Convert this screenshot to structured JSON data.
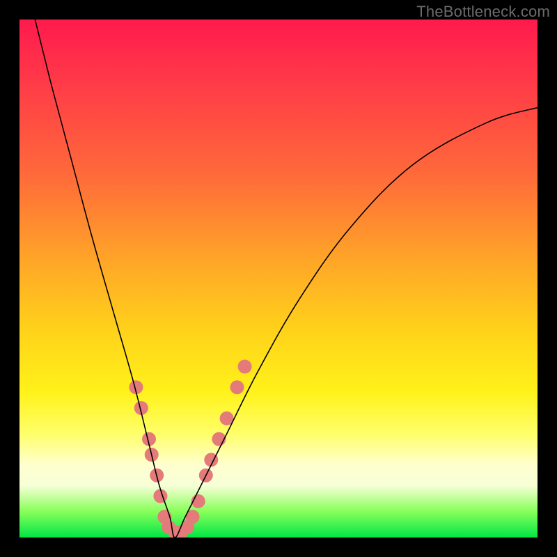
{
  "watermark": {
    "text": "TheBottleneck.com"
  },
  "chart_data": {
    "type": "line",
    "title": "",
    "xlabel": "",
    "ylabel": "",
    "xlim": [
      0,
      100
    ],
    "ylim": [
      0,
      100
    ],
    "grid": false,
    "legend": false,
    "series": [
      {
        "name": "bottleneck-curve",
        "x": [
          3,
          6,
          10,
          14,
          18,
          22,
          25,
          27,
          29,
          30,
          32,
          35,
          40,
          46,
          54,
          64,
          76,
          90,
          100
        ],
        "y": [
          100,
          88,
          73,
          58,
          44,
          30,
          18,
          10,
          4,
          0,
          4,
          10,
          20,
          32,
          46,
          60,
          72,
          80,
          83
        ],
        "stroke": "#000000",
        "width": 1.6
      }
    ],
    "markers": {
      "name": "highlight-dots",
      "color": "#e47a7a",
      "radius_px": 10,
      "points": [
        {
          "x": 22.5,
          "y": 29
        },
        {
          "x": 23.5,
          "y": 25
        },
        {
          "x": 25.0,
          "y": 19
        },
        {
          "x": 25.5,
          "y": 16
        },
        {
          "x": 26.5,
          "y": 12
        },
        {
          "x": 27.2,
          "y": 8
        },
        {
          "x": 28.0,
          "y": 4
        },
        {
          "x": 28.8,
          "y": 2
        },
        {
          "x": 30.0,
          "y": 1
        },
        {
          "x": 31.2,
          "y": 1
        },
        {
          "x": 32.4,
          "y": 2
        },
        {
          "x": 33.4,
          "y": 4
        },
        {
          "x": 34.5,
          "y": 7
        },
        {
          "x": 36.0,
          "y": 12
        },
        {
          "x": 37.0,
          "y": 15
        },
        {
          "x": 38.5,
          "y": 19
        },
        {
          "x": 40.0,
          "y": 23
        },
        {
          "x": 42.0,
          "y": 29
        },
        {
          "x": 43.5,
          "y": 33
        }
      ]
    },
    "gradient_stops": [
      {
        "pos": 0,
        "color": "#ff1a4d"
      },
      {
        "pos": 12,
        "color": "#ff3a48"
      },
      {
        "pos": 30,
        "color": "#ff6a3a"
      },
      {
        "pos": 45,
        "color": "#ffa029"
      },
      {
        "pos": 60,
        "color": "#ffd21a"
      },
      {
        "pos": 72,
        "color": "#fff21a"
      },
      {
        "pos": 80,
        "color": "#ffff6a"
      },
      {
        "pos": 86,
        "color": "#ffffd0"
      },
      {
        "pos": 90,
        "color": "#f6ffd6"
      },
      {
        "pos": 95,
        "color": "#87ff5a"
      },
      {
        "pos": 100,
        "color": "#00e646"
      }
    ]
  }
}
